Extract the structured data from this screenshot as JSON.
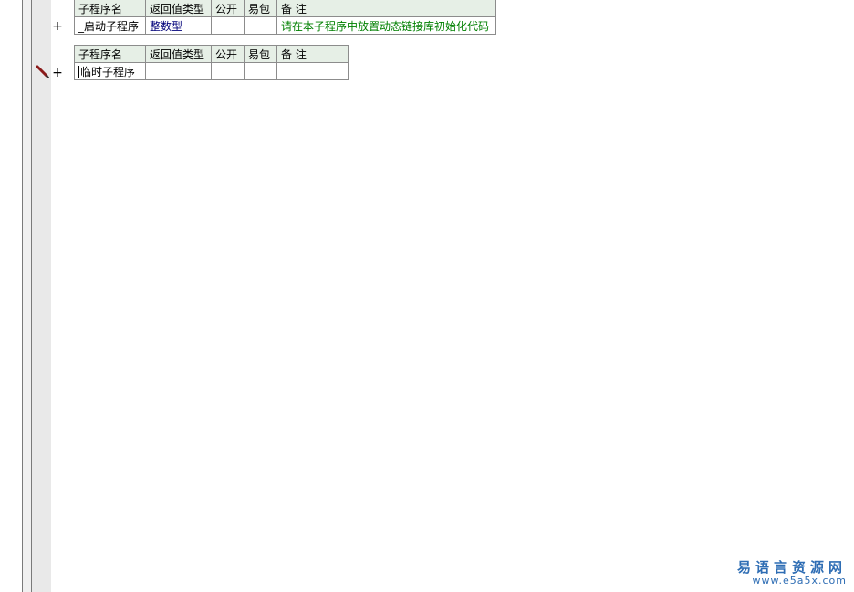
{
  "table1": {
    "headers": {
      "name": "子程序名",
      "return_type": "返回值类型",
      "public": "公开",
      "easy_pack": "易包",
      "note": "备 注"
    },
    "row": {
      "name": "_启动子程序",
      "return_type": "整数型",
      "public": "",
      "easy_pack": "",
      "note": "请在本子程序中放置动态链接库初始化代码"
    }
  },
  "table2": {
    "headers": {
      "name": "子程序名",
      "return_type": "返回值类型",
      "public": "公开",
      "easy_pack": "易包",
      "note": "备 注"
    },
    "row": {
      "name": "临时子程序",
      "return_type": "",
      "public": "",
      "easy_pack": "",
      "note": ""
    }
  },
  "gutter": {
    "expand_symbol": "+"
  },
  "watermark": {
    "title": "易语言资源网",
    "url": "www.e5a5x.com"
  },
  "colors": {
    "header_bg": "#e6efe6",
    "type_text": "#00007a",
    "note_text": "#008000",
    "watermark": "#2e6db4",
    "pencil": "#8b1a1a"
  },
  "icons": {
    "edit_marker": "pencil-icon",
    "expand": "plus-icon"
  }
}
